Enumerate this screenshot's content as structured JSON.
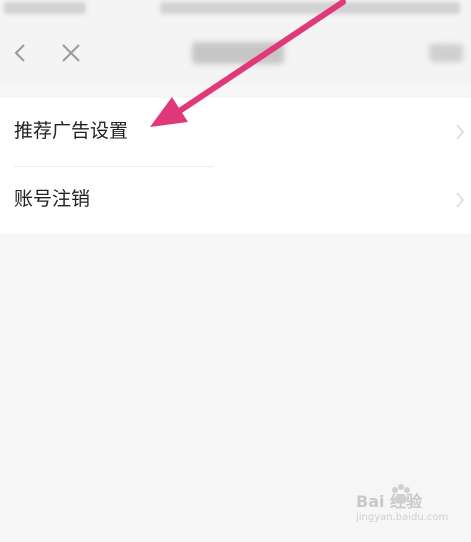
{
  "menu": {
    "items": [
      {
        "label": "推荐广告设置"
      },
      {
        "label": "账号注销"
      }
    ]
  },
  "watermark": {
    "logo_text": "Bai 经验",
    "url": "jingyan.baidu.com"
  },
  "colors": {
    "arrow": "#e0397a",
    "background": "#f6f6f6",
    "card": "#ffffff"
  },
  "icons": [
    "back-icon",
    "close-icon",
    "chevron-right-icon",
    "paw-icon"
  ]
}
